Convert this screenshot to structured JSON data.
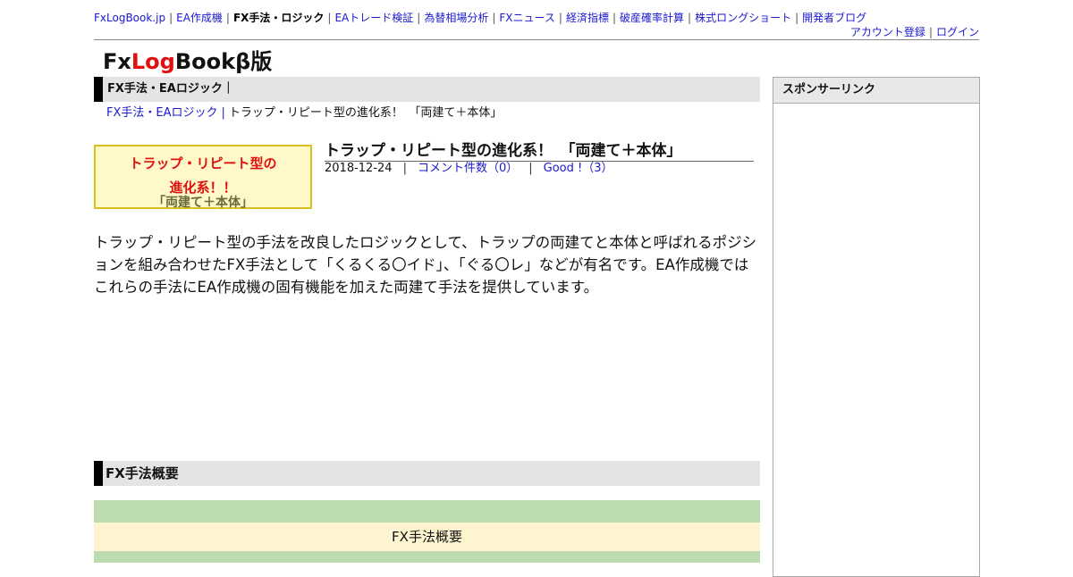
{
  "topnav": {
    "items": [
      "FxLogBook.jp",
      "EA作成機",
      "FX手法・ロジック",
      "EAトレード検証",
      "為替相場分析",
      "FXニュース",
      "経済指標",
      "破産確率計算",
      "株式ロングショート",
      "開発者ブログ"
    ],
    "current_index": 2,
    "separator": "|"
  },
  "subnav": {
    "account": "アカウント登録",
    "login": "ログイン",
    "separator": "|"
  },
  "logo": {
    "part1": "Fx",
    "part2": "Log",
    "part3": "Bookβ版"
  },
  "section1": {
    "title": "FX手法・EAロジック｜"
  },
  "breadcrumb": {
    "parent": "FX手法・EAロジック",
    "separator": "|",
    "current": "トラップ・リピート型の進化系！　「両建て＋本体」"
  },
  "thumb": {
    "line1": "トラップ・リピート型の",
    "line2": "進化系！！",
    "line3": "「両建て＋本体」"
  },
  "article": {
    "title": "トラップ・リピート型の進化系！　「両建て＋本体」",
    "date": "2018-12-24",
    "sep": "|",
    "comments": "コメント件数（0）",
    "good": "Good !（3）",
    "body": "トラップ・リピート型の手法を改良したロジックとして、トラップの両建てと本体と呼ばれるポジションを組み合わせたFX手法として「くるくる〇イド」、「ぐる〇レ」などが有名です。EA作成機ではこれらの手法にEA作成機の固有機能を加えた両建て手法を提供しています。"
  },
  "section2": {
    "title": "FX手法概要"
  },
  "summary_table": {
    "header": "FX手法概要"
  },
  "sidebar": {
    "title": "スポンサーリンク"
  },
  "colors": {
    "link": "#1a1acc",
    "accent_red": "#e01010",
    "green_bar": "#bcdcb0",
    "cream": "#fff4d0",
    "thumb_bg": "#fff8c8",
    "thumb_border": "#d8c020"
  }
}
